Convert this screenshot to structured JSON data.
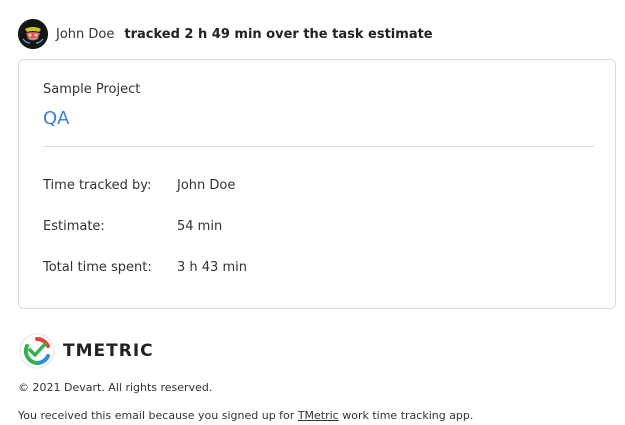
{
  "header": {
    "user_name": "John Doe",
    "action_text": "tracked 2 h 49 min over the task estimate"
  },
  "card": {
    "project_name": "Sample Project",
    "task_name": "QA",
    "rows": [
      {
        "label": "Time tracked by:",
        "value": "John Doe"
      },
      {
        "label": "Estimate:",
        "value": "54 min"
      },
      {
        "label": "Total time spent:",
        "value": "3 h 43 min"
      }
    ]
  },
  "footer": {
    "logo_text": "TMETRIC",
    "copyright": "© 2021 Devart. All rights reserved.",
    "note_before": "You received this email because you signed up for ",
    "note_link": "TMetric",
    "note_after": " work time tracking app."
  },
  "colors": {
    "link_blue": "#3b7ddd",
    "logo_green": "#2fb34a",
    "logo_red": "#e8413c",
    "logo_blue": "#2d8fe0"
  },
  "icons": {
    "avatar": "avatar-image",
    "logo": "tmetric-logo-icon"
  }
}
